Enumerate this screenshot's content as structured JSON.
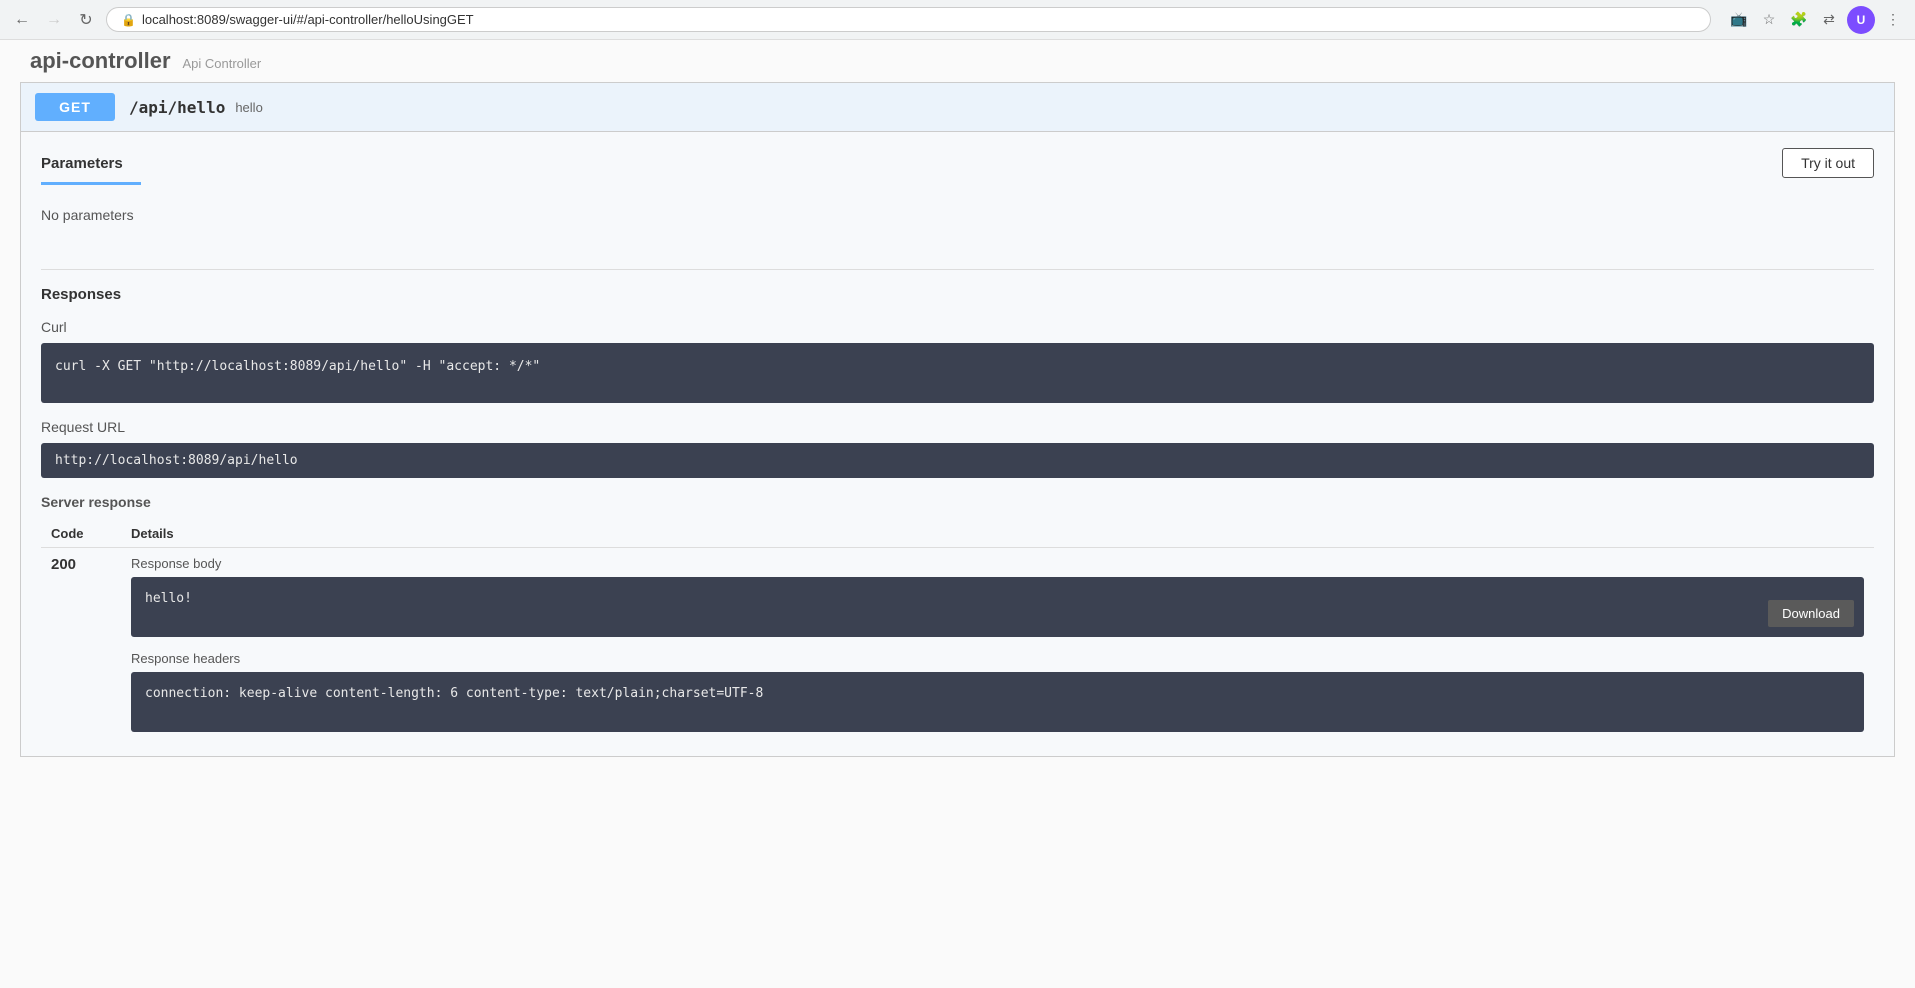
{
  "browser": {
    "url": "localhost:8089/swagger-ui/#/api-controller/helloUsingGET",
    "back_disabled": false,
    "forward_disabled": true
  },
  "header": {
    "controller_name": "api-controller",
    "controller_sub": "Api Controller"
  },
  "endpoint": {
    "method": "GET",
    "path": "/api/hello",
    "description": "hello"
  },
  "parameters": {
    "section_title": "Parameters",
    "no_params_text": "No parameters",
    "try_it_out_label": "Try it out"
  },
  "responses": {
    "section_title": "Responses",
    "curl_label": "Curl",
    "curl_command": "curl -X GET \"http://localhost:8089/api/hello\" -H \"accept: */*\"",
    "request_url_label": "Request URL",
    "request_url_value": "http://localhost:8089/api/hello",
    "server_response_label": "Server response",
    "code_col": "Code",
    "details_col": "Details",
    "response_code": "200",
    "response_body_label": "Response body",
    "response_body_value": "hello!",
    "download_label": "Download",
    "response_headers_label": "Response headers",
    "response_headers_value": "connection: keep-alive\ncontent-length: 6\ncontent-type: text/plain;charset=UTF-8"
  }
}
